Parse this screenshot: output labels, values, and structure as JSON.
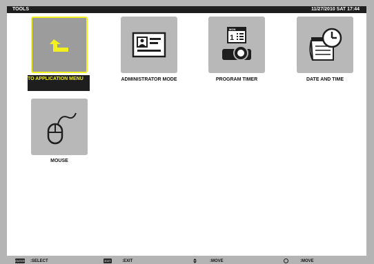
{
  "header": {
    "title": "TOOLS",
    "datetime": "11/27/2010 SAT 17:44"
  },
  "menu": {
    "items": [
      {
        "label": "TO APPLICATION MENU",
        "icon": "return-arrow-icon",
        "selected": true
      },
      {
        "label": "ADMINISTRATOR MODE",
        "icon": "id-card-icon",
        "selected": false
      },
      {
        "label": "PROGRAM TIMER",
        "icon": "timer-calendar-icon",
        "selected": false
      },
      {
        "label": "DATE AND TIME",
        "icon": "calendar-clock-icon",
        "selected": false
      },
      {
        "label": "MOUSE",
        "icon": "mouse-icon",
        "selected": false
      }
    ]
  },
  "footer": {
    "hints": [
      {
        "key": "ENTER",
        "text": ":SELECT"
      },
      {
        "key": "EXIT",
        "text": ":EXIT"
      },
      {
        "key": "",
        "text": ":MOVE"
      },
      {
        "key": "",
        "text": ":MOVE"
      }
    ]
  },
  "colors": {
    "highlight": "#f3f020",
    "background": "#b4b4b4",
    "panel": "#ffffff",
    "tile": "#b8b8b8"
  }
}
